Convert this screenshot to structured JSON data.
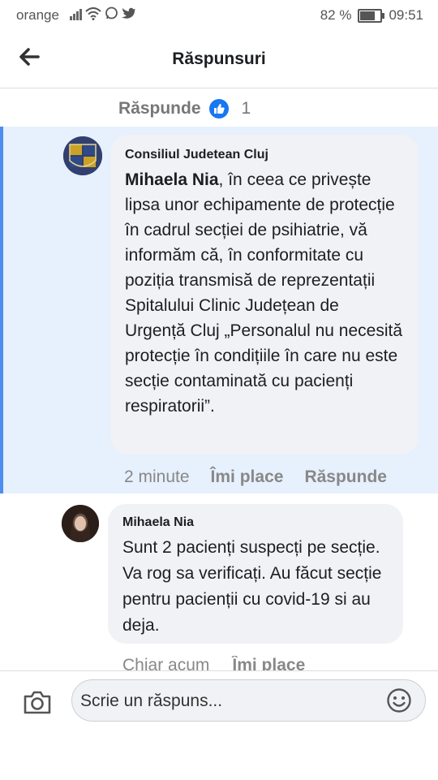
{
  "status_bar": {
    "carrier": "orange",
    "battery_percent": "82 %",
    "battery_level": 0.82,
    "time": "09:51"
  },
  "header": {
    "title": "Răspunsuri"
  },
  "top_actions": {
    "reply_label": "Răspunde",
    "like_count": "1"
  },
  "comments": [
    {
      "author": "Consiliul Judetean Cluj",
      "mention": "Mihaela Nia",
      "text": ", în ceea ce privește lipsa unor echipamente de protecție în cadrul secției de psihiatrie, vă informăm că, în conformitate cu poziția transmisă de reprezentații Spitalului Clinic Județean de Urgență Cluj „Personalul nu necesită protecție în condițiile în care nu este secție contaminată cu pacienți respiratorii”.",
      "time": "2 minute",
      "like_label": "Îmi place",
      "reply_label": "Răspunde"
    },
    {
      "author": "Mihaela Nia",
      "text": "Sunt 2 pacienți suspecți pe secție. Va rog sa verificați. Au făcut secție pentru pacienții cu covid-19 si au deja.",
      "time": "Chiar acum",
      "like_label": "Îmi place"
    }
  ],
  "composer": {
    "placeholder": "Scrie un răspuns..."
  },
  "colors": {
    "accent": "#1877f2",
    "highlight_bg": "#e7f0fd",
    "highlight_border": "#4b8ef0",
    "bubble_bg": "#f0f2f5"
  }
}
